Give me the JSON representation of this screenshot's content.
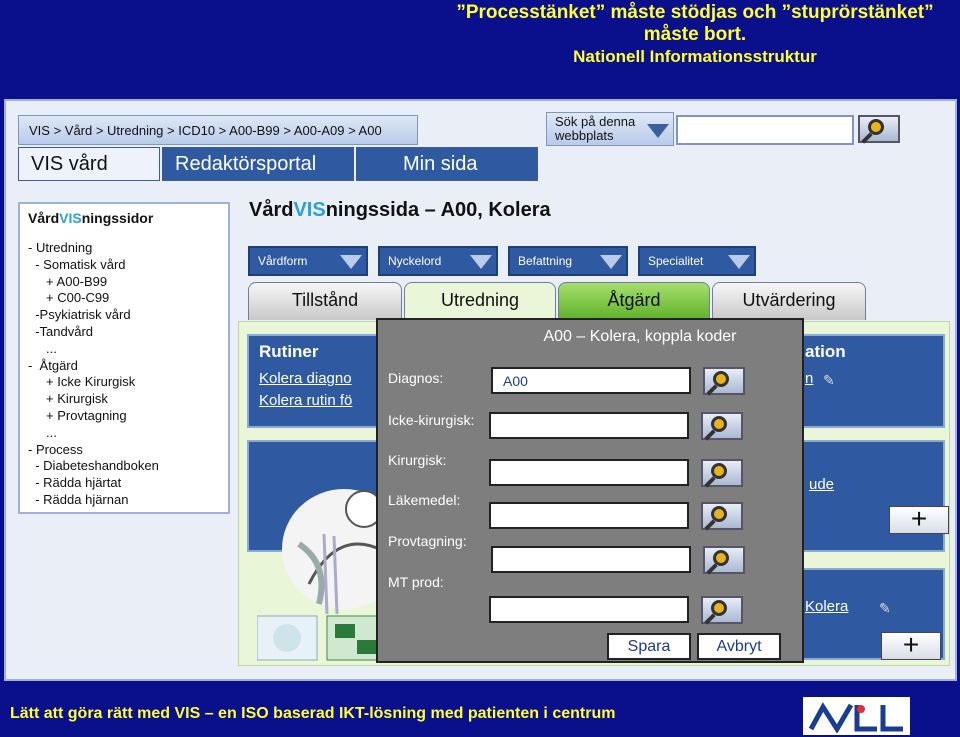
{
  "slide": {
    "title_line1": "”Processtänket” måste stödjas och ”stuprörstänket” måste bort.",
    "title_line2": "Nationell Informationsstruktur",
    "footer": "Lätt att göra rätt med VIS – en ISO baserad IKT-lösning med patienten i centrum",
    "logo_icon": "nll-logo-icon"
  },
  "header": {
    "breadcrumb": "VIS > Vård > Utredning > ICD10 > A00-B99 > A00-A09 > A00",
    "search_label": "Sök på denna webbplats",
    "search_value": ""
  },
  "top_tabs": [
    "VIS vård",
    "Redaktörsportal",
    "Min sida"
  ],
  "leftnav": {
    "head_prefix": "Vård",
    "head_vis": "VIS",
    "head_suffix": "ningssidor",
    "items": [
      "- Utredning",
      "  - Somatisk vård",
      "     + A00-B99",
      "     + C00-C99",
      "  -Psykiatrisk vård",
      "  -Tandvård",
      "     ...",
      "-  Åtgärd",
      "     + Icke Kirurgisk",
      "     + Kirurgisk",
      "     + Provtagning",
      "     ...",
      "- Process",
      "  - Diabeteshandboken",
      "  - Rädda hjärtat",
      "  - Rädda hjärnan"
    ]
  },
  "page_title": {
    "prefix": "Vård",
    "vis": "VIS",
    "suffix": "ningssida – A00, Kolera"
  },
  "filters": [
    "Vårdform",
    "Nyckelord",
    "Befattning",
    "Specialitet"
  ],
  "content_tabs": [
    "Tillstånd",
    "Utredning",
    "Åtgärd",
    "Utvärdering"
  ],
  "panels": {
    "rutiner_title": "Rutiner",
    "rutiner_link1": "Kolera diagno",
    "rutiner_link2": "Kolera rutin fö",
    "right_title_fragment": "ation",
    "right_link1_fragment": "n",
    "right_link2_fragment": "ude",
    "right_link3_fragment": "Kolera",
    "plus": "+"
  },
  "modal": {
    "title": "A00 – Kolera, koppla koder",
    "fields": [
      {
        "label": "Diagnos:",
        "value": "A00"
      },
      {
        "label": "Icke-kirurgisk:",
        "value": ""
      },
      {
        "label": "Kirurgisk:",
        "value": ""
      },
      {
        "label": "Läkemedel:",
        "value": ""
      },
      {
        "label": "Provtagning:",
        "value": ""
      },
      {
        "label": "MT prod:",
        "value": ""
      }
    ],
    "save": "Spara",
    "cancel": "Avbryt"
  }
}
